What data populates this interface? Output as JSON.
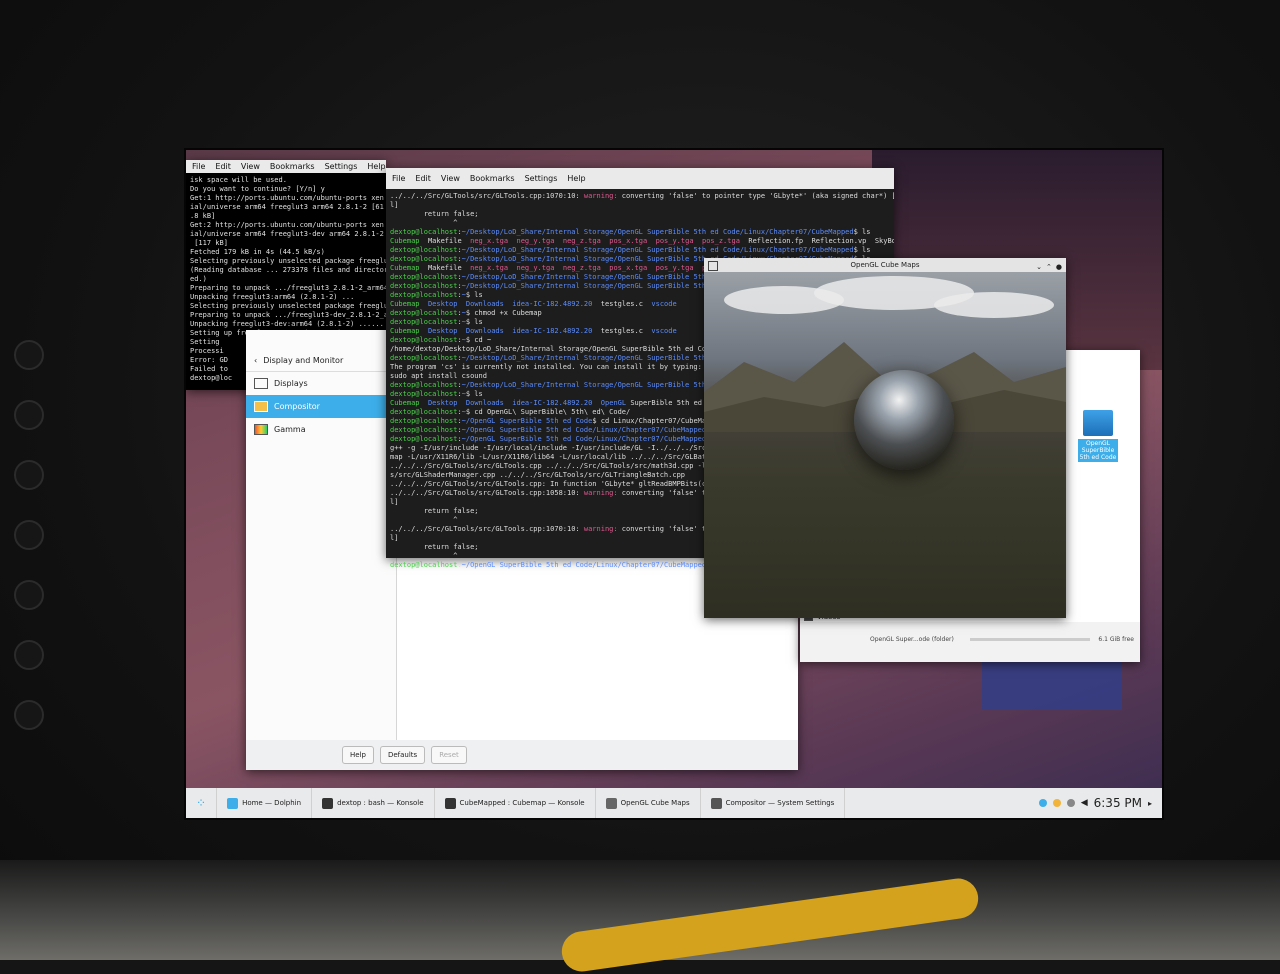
{
  "terminal_apt": {
    "menu": [
      "File",
      "Edit",
      "View",
      "Bookmarks",
      "Settings",
      "Help"
    ],
    "lines": [
      "isk space will be used.",
      "Do you want to continue? [Y/n] y",
      "Get:1 http://ports.ubuntu.com/ubuntu-ports xen",
      "ial/universe arm64 freeglut3 arm64 2.8.1-2 [61",
      ".8 kB]",
      "Get:2 http://ports.ubuntu.com/ubuntu-ports xen",
      "ial/universe arm64 freeglut3-dev arm64 2.8.1-2",
      " [117 kB]",
      "Fetched 179 kB in 4s (44.5 kB/s)",
      "Selecting previously unselected package freeglu",
      "(Reading database ... 273378 files and directori",
      "ed.)",
      "Preparing to unpack .../freeglut3_2.8.1-2_arm64",
      "Unpacking freeglut3:arm64 (2.8.1-2) ...",
      "Selecting previously unselected package freeglut",
      "Preparing to unpack .../freeglut3-dev_2.8.1-2_ar",
      "Unpacking freeglut3-dev:arm64 (2.8.1-2) ......",
      "Setting up freeglut3:arm64 (2.8.1-2) ...",
      "Setting",
      "Processi",
      "Error: GD",
      "Failed to",
      "dextop@loc"
    ]
  },
  "system_settings": {
    "header": "Display and Monitor",
    "items": [
      "Displays",
      "Compositor",
      "Gamma"
    ],
    "active_index": 1,
    "buttons": {
      "help": "Help",
      "defaults": "Defaults",
      "reset": "Reset"
    }
  },
  "terminal_cube": {
    "menu": [
      "File",
      "Edit",
      "View",
      "Bookmarks",
      "Settings",
      "Help"
    ],
    "lines": [
      "../../../Src/GLTools/src/GLTools.cpp:1070:10: warning: converting 'false' to pointer type 'GLbyte*' (aka signed char*) [-Wconversion-nul",
      "l]",
      "        return false;",
      "               ^",
      "dextop@localhost:~/Desktop/LoD_Share/Internal Storage/OpenGL SuperBible 5th ed Code/Linux/Chapter07/CubeMapped$ ls",
      "Cubemap  Makefile  neg_x.tga  neg_y.tga  neg_z.tga  pos_x.tga  pos_y.tga  pos_z.tga  Reflection.fp  Reflection.vp  SkyBox.fp  SkyBox.vp",
      "dextop@localhost:~/Desktop/LoD_Share/Internal Storage/OpenGL SuperBible 5th ed Code/Linux/Chapter07/CubeMapped$ ls",
      "dextop@localhost:~/Desktop/LoD_Share/Internal Storage/OpenGL SuperBible 5th ed Code/Linux/Chapter07/CubeMapped$ ls",
      "Cubemap  Makefile  neg_x.tga  neg_y.tga  neg_z.tga  pos_x.tga  pos_y.tga  pos_z.tga  Reflection.fp  Reflection.vp",
      "dextop@localhost:~/Desktop/LoD_Share/Internal Storage/OpenGL SuperBible 5th ed Code/Linux/Chapter07/CubeMapped$ chmod +x Cubemap",
      "dextop@localhost:~/Desktop/LoD_Share/Internal Storage/OpenGL SuperBible 5th ed Code/Linux/Chapter07/CubeMapped$ ",
      "dextop@localhost:~$ ls",
      "Cubemap  Desktop  Downloads  idea-IC-182.4892.20  testgles.c  vscode",
      "dextop@localhost:~$ chmod +x Cubemap",
      "dextop@localhost:~$ ls",
      "Cubemap  Desktop  Downloads  idea-IC-182.4892.20  testgles.c  vscode",
      "dextop@localhost:~$ cd ~",
      "/home/dextop/Desktop/LoD_Share/Internal Storage/OpenGL SuperBible 5th ed Code/",
      "dextop@localhost:~/Desktop/LoD_Share/Internal Storage/OpenGL SuperBible 5th ed",
      "The program 'cs' is currently not installed. You can install it by typing:",
      "sudo apt install csound",
      "dextop@localhost:~/Desktop/LoD_Share/Internal Storage/OpenGL SuperBible 5th ed",
      "dextop@localhost:~$ ls",
      "Cubemap  Desktop  Downloads  idea-IC-182.4892.20  OpenGL SuperBible 5th ed Code",
      "dextop@localhost:~$ cd OpenGL\\ SuperBible\\ 5th\\ ed\\ Code/",
      "dextop@localhost:~/OpenGL SuperBible 5th ed Code$ cd Linux/Chapter07/CubeMapped",
      "dextop@localhost:~/OpenGL SuperBible 5th ed Code/Linux/Chapter07/CubeMapped$ ma",
      "dextop@localhost:~/OpenGL SuperBible 5th ed Code/Linux/Chapter07/CubeMapped$ make",
      "g++ -g -I/usr/include -I/usr/local/include -I/usr/include/GL -I../../../Src/GLT",
      "map -L/usr/X11R6/lib -L/usr/X11R6/lib64 -L/usr/local/lib ../../../Src/GLBatch.cpp",
      "../../../Src/GLTools/src/GLTools.cpp ../../../Src/GLTools/src/math3d.cpp -lX11 -lglut -l",
      "s/src/GLShaderManager.cpp ../../../Src/GLTools/src/GLTriangleBatch.cpp",
      "../../../Src/GLTools/src/GLTools.cpp: In function 'GLbyte* gltReadBMPBits(const",
      "../../../Src/GLTools/src/GLTools.cpp:1058:10: warning: converting 'false' to po",
      "l]",
      "        return false;",
      "               ^",
      "../../../Src/GLTools/src/GLTools.cpp:1070:10: warning: converting 'false' to po",
      "l]",
      "        return false;",
      "               ^",
      "dextop@localhost:~/OpenGL SuperBible 5th ed Code/Linux/Chapter07/CubeMapped$ "
    ]
  },
  "dolphin": {
    "folder_label": "OpenGL SuperBible 5th ed Code",
    "places_item": "Videos",
    "status_text": "OpenGL Super...ode (folder)",
    "free_space": "6.1 GiB free"
  },
  "opengl_window": {
    "title": "OpenGL Cube Maps"
  },
  "taskbar": {
    "items": [
      "Home — Dolphin",
      "dextop : bash — Konsole",
      "CubeMapped : Cubemap — Konsole",
      "OpenGL Cube Maps",
      "Compositor — System Settings"
    ],
    "clock": "6:35 PM"
  },
  "colors": {
    "accent": "#3daee9",
    "prompt": "#4bd24b",
    "path": "#5b8cff",
    "warning": "#e0598f"
  }
}
